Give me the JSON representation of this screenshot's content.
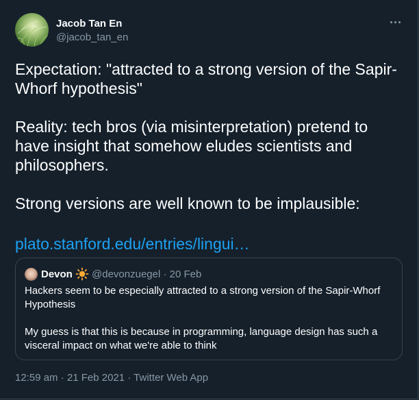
{
  "author": {
    "display_name": "Jacob Tan En",
    "handle": "@jacob_tan_en",
    "avatar_icon": "grass-photo-avatar"
  },
  "more_icon": "more-dots-icon",
  "tweet": {
    "line1": "Expectation: \"attracted to a strong version of the Sapir-Whorf hypothesis\"",
    "line2": "Reality: tech bros (via misinterpretation) pretend to have insight that somehow eludes scientists and philosophers.",
    "line3": "Strong versions are well known to be implausible:",
    "link": "plato.stanford.edu/entries/lingui…"
  },
  "quoted": {
    "display_name": "Devon",
    "emoji": "sun-icon",
    "handle_date": "@devonzuegel · 20 Feb",
    "text1": "Hackers seem to be especially attracted to a strong version of the Sapir-Whorf Hypothesis",
    "text2": "My guess is that this is because in programming, language design has such a visceral impact on what we're able to think"
  },
  "meta": {
    "timestamp": "12:59 am · 21 Feb 2021 · ",
    "source": "Twitter Web App"
  },
  "colors": {
    "background": "#15202b",
    "border": "#38444d",
    "secondary_text": "#8899a6",
    "link": "#1da1f2",
    "sun": "#ffac33"
  }
}
